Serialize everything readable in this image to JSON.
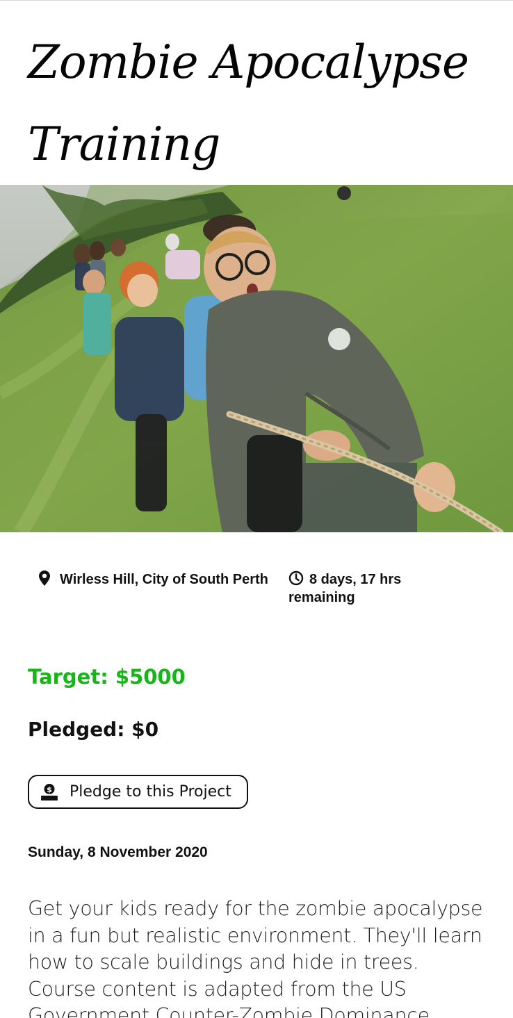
{
  "project": {
    "title": "Zombie Apocalypse Training",
    "image_alt": "Children playing tug of war in a grassy field",
    "location": "Wirless Hill, City of South Perth",
    "time_remaining": "8 days, 17 hrs remaining",
    "target": "Target: $5000",
    "pledged": "Pledged: $0",
    "pledge_button_label": "Pledge to this Project",
    "date": "Sunday, 8 November 2020",
    "description": "Get your kids ready for the zombie apocalypse in a fun but realistic environment. They'll learn how to scale buildings and hide in trees. Course content is adapted from the US Government Counter-Zombie Dominance"
  },
  "icons": {
    "location": "map-pin-icon",
    "time": "clock-icon",
    "pledge": "money-hand-icon"
  },
  "colors": {
    "target": "#17b517",
    "text": "#111111",
    "background": "#ffffff"
  }
}
